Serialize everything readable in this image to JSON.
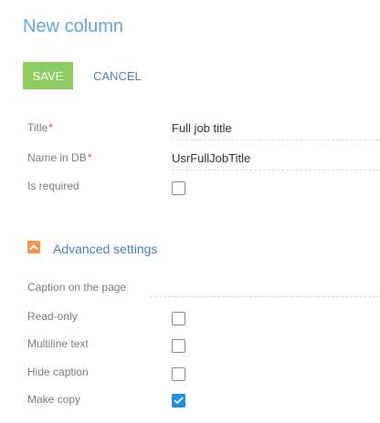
{
  "page": {
    "title": "New column"
  },
  "toolbar": {
    "save_label": "SAVE",
    "cancel_label": "CANCEL"
  },
  "fields": {
    "title": {
      "label": "Title",
      "required_mark": "*",
      "value": "Full job title"
    },
    "name_in_db": {
      "label": "Name in DB",
      "required_mark": "*",
      "value": "UsrFullJobTitle"
    },
    "is_required": {
      "label": "Is required",
      "checked": false
    }
  },
  "advanced": {
    "section_title": "Advanced settings",
    "expanded": true,
    "caption_on_page": {
      "label": "Caption on the page",
      "value": ""
    },
    "read_only": {
      "label": "Read-only",
      "checked": false
    },
    "multiline_text": {
      "label": "Multiline text",
      "checked": false
    },
    "hide_caption": {
      "label": "Hide caption",
      "checked": false
    },
    "make_copy": {
      "label": "Make copy",
      "checked": true
    }
  },
  "colors": {
    "accent_blue": "#5ea7de",
    "save_green": "#8ecb60",
    "toggle_orange": "#f2954f",
    "checkbox_blue": "#1e8fe0",
    "required_red": "#d9534f"
  },
  "icons": {
    "section_toggle": "chevron-up-icon",
    "checkmark": "checkmark-icon"
  }
}
